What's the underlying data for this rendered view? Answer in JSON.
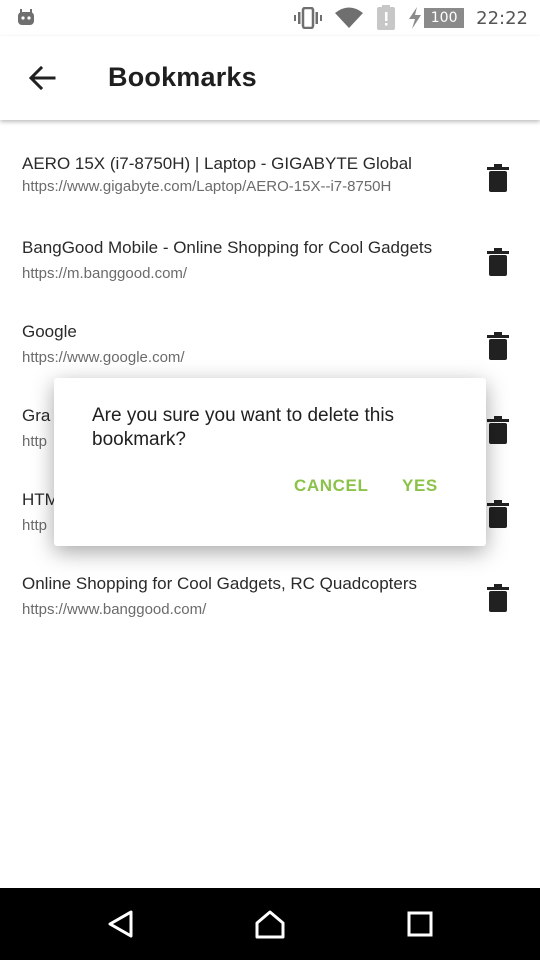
{
  "status_bar": {
    "time": "22:22",
    "battery_level": "100",
    "icons": [
      "android-icon",
      "vibrate-icon",
      "wifi-icon",
      "alert-icon",
      "charging-icon",
      "battery-icon"
    ]
  },
  "app_bar": {
    "title": "Bookmarks",
    "back_icon": "arrow-back-icon"
  },
  "bookmarks": [
    {
      "title": "AERO 15X (i7-8750H) | Laptop - GIGABYTE Global",
      "url": "https://www.gigabyte.com/Laptop/AERO-15X--i7-8750H"
    },
    {
      "title": "BangGood Mobile - Online Shopping for Cool Gadgets",
      "url": "https://m.banggood.com/"
    },
    {
      "title": "Google",
      "url": "https://www.google.com/"
    },
    {
      "title": "Gra",
      "url": "http"
    },
    {
      "title": "HTM",
      "url": "http"
    },
    {
      "title": "Online Shopping for Cool Gadgets, RC Quadcopters",
      "url": "https://www.banggood.com/"
    }
  ],
  "dialog": {
    "message": "Are you sure you want to delete this bookmark?",
    "cancel_label": "CANCEL",
    "yes_label": "YES"
  },
  "nav_bar": {
    "icons": [
      "back-triangle-icon",
      "home-icon",
      "recents-icon"
    ]
  },
  "colors": {
    "accent": "#8bc34a",
    "icon_dark": "#212121",
    "url_gray": "#6b6b6b",
    "nav_background": "#000000"
  }
}
